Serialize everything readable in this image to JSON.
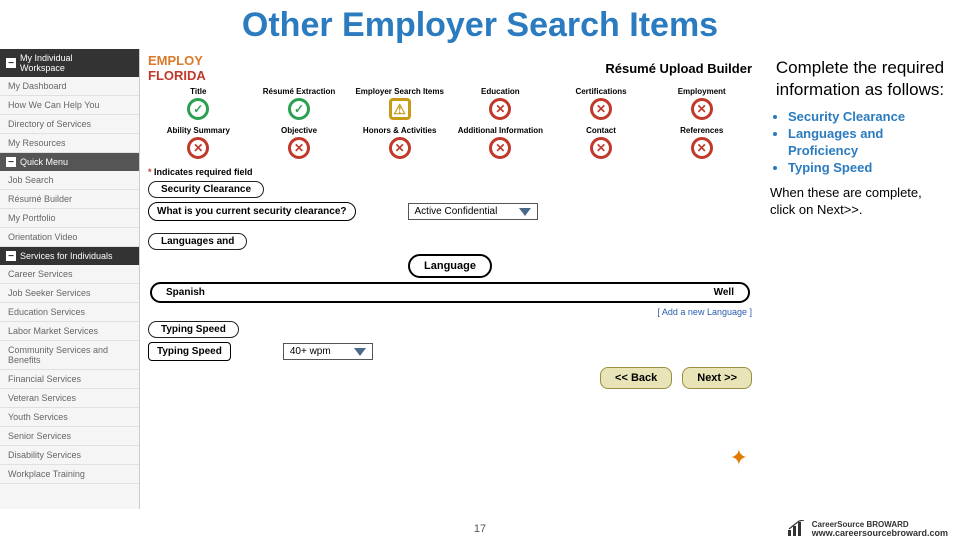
{
  "slide_title": "Other Employer Search Items",
  "sidebar": {
    "hdr1": "My Individual",
    "hdr1b": "Workspace",
    "items1": [
      "My Dashboard",
      "How We Can Help You",
      "Directory of Services",
      "My Resources"
    ],
    "hdr2": "Quick Menu",
    "items2": [
      "Job Search",
      "Résumé Builder",
      "My Portfolio",
      "Orientation Video"
    ],
    "hdr3": "Services for Individuals",
    "items3": [
      "Career Services",
      "Job Seeker Services",
      "Education Services",
      "Labor Market Services",
      "Community Services and Benefits",
      "Financial Services",
      "Veteran Services",
      "Youth Services",
      "Senior Services",
      "Disability Services",
      "Workplace Training"
    ]
  },
  "main": {
    "logo_top": "EMPLOY",
    "logo_bot": "FLORIDA",
    "builder_title": "Résumé Upload Builder",
    "steps_row1": [
      "Title",
      "Résumé Extraction",
      "Employer Search Items",
      "Education",
      "Certifications",
      "Employment"
    ],
    "steps_row2": [
      "Ability Summary",
      "Objective",
      "Honors & Activities",
      "Additional Information",
      "Contact",
      "References"
    ],
    "req_note": "Indicates required field",
    "sec_clear_hdr": "Security Clearance",
    "sec_clear_q": "What is you current security clearance?",
    "sec_clear_val": "Active Confidential",
    "lang_hdr": "Languages and",
    "lang_sub": "Language",
    "lang_name": "Spanish",
    "lang_prof": "Well",
    "add_lang": "[ Add a new Language ]",
    "typing_hdr": "Typing Speed",
    "typing_label": "Typing Speed",
    "typing_val": "40+ wpm",
    "back": "<< Back",
    "next": "Next >>"
  },
  "right": {
    "p1a": "Complete the required information as follows:",
    "b1": "Security Clearance",
    "b2": "Languages and Proficiency",
    "b3": "Typing Speed",
    "p2": "When these are complete, click on Next>>."
  },
  "footer": {
    "page": "17",
    "url": "www.careersourcebroward.com",
    "brand": "CareerSource BROWARD"
  }
}
